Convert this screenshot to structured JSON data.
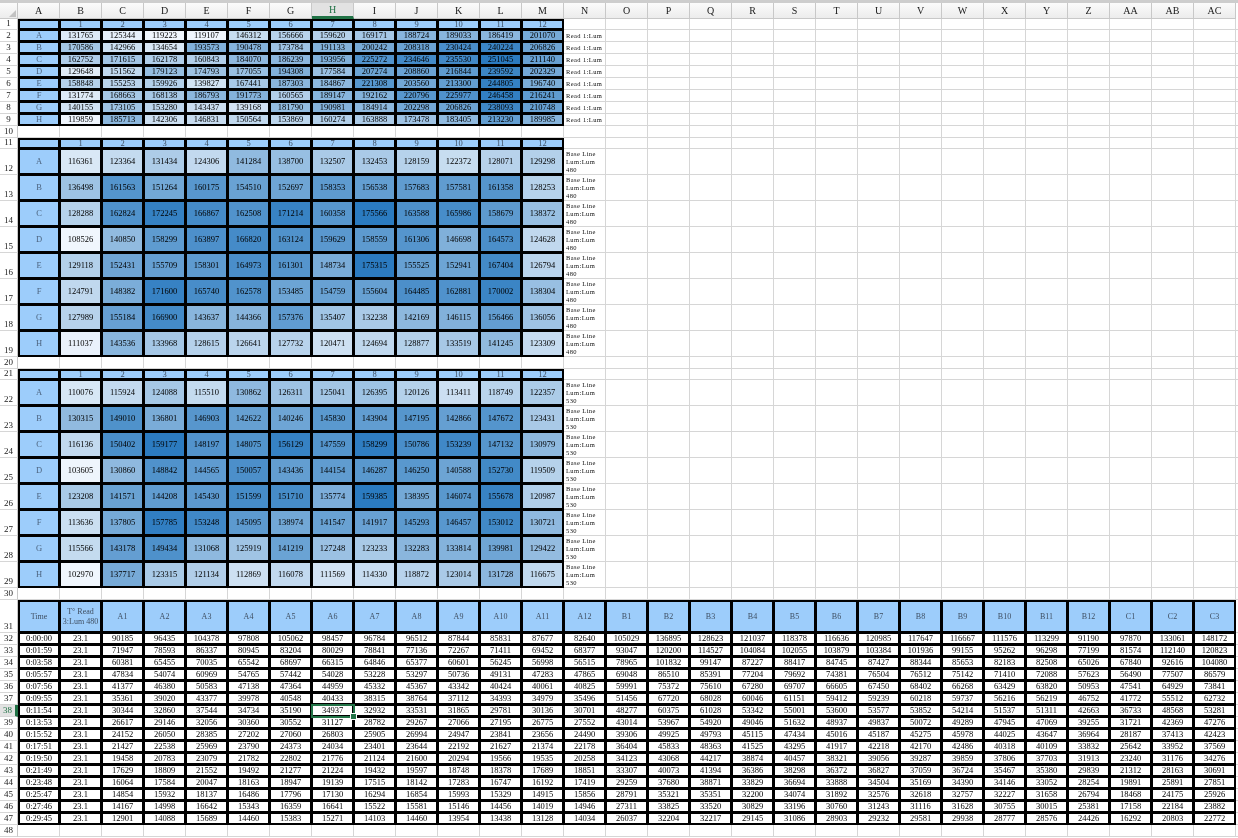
{
  "column_headers": [
    {
      "label": "A",
      "selected": false
    },
    {
      "label": "B",
      "selected": false
    },
    {
      "label": "C",
      "selected": false
    },
    {
      "label": "D",
      "selected": false
    },
    {
      "label": "E",
      "selected": false
    },
    {
      "label": "F",
      "selected": false
    },
    {
      "label": "G",
      "selected": false
    },
    {
      "label": "H",
      "selected": true
    },
    {
      "label": "I",
      "selected": false
    },
    {
      "label": "J",
      "selected": false
    },
    {
      "label": "K",
      "selected": false
    },
    {
      "label": "L",
      "selected": false
    },
    {
      "label": "M",
      "selected": false
    },
    {
      "label": "N",
      "selected": false
    },
    {
      "label": "O",
      "selected": false
    },
    {
      "label": "P",
      "selected": false
    },
    {
      "label": "Q",
      "selected": false
    },
    {
      "label": "R",
      "selected": false
    },
    {
      "label": "S",
      "selected": false
    },
    {
      "label": "T",
      "selected": false
    },
    {
      "label": "U",
      "selected": false
    },
    {
      "label": "V",
      "selected": false
    },
    {
      "label": "W",
      "selected": false
    },
    {
      "label": "X",
      "selected": false
    },
    {
      "label": "Y",
      "selected": false
    },
    {
      "label": "Z",
      "selected": false
    },
    {
      "label": "AA",
      "selected": false
    },
    {
      "label": "AB",
      "selected": false
    },
    {
      "label": "AC",
      "selected": false
    }
  ],
  "rows": [
    {
      "number": "1",
      "selected": false,
      "kind": "plate_head",
      "labels": [
        "1",
        "2",
        "3",
        "4",
        "5",
        "6",
        "7",
        "8",
        "9",
        "10",
        "11",
        "12"
      ]
    },
    {
      "number": "2",
      "selected": false,
      "kind": "plate_row",
      "label": "A",
      "values": [
        "131765",
        "125344",
        "119223",
        "119107",
        "146312",
        "156666",
        "159620",
        "169171",
        "188724",
        "189033",
        "186419",
        "201070"
      ],
      "note": "Read 1:Lum"
    },
    {
      "number": "3",
      "selected": false,
      "kind": "plate_row",
      "label": "B",
      "values": [
        "170586",
        "142966",
        "134654",
        "193573",
        "190478",
        "173784",
        "191133",
        "200242",
        "208318",
        "230424",
        "240224",
        "206826"
      ],
      "note": "Read 1:Lum"
    },
    {
      "number": "4",
      "selected": false,
      "kind": "plate_row",
      "label": "C",
      "values": [
        "162752",
        "171615",
        "162178",
        "160843",
        "184070",
        "186239",
        "193956",
        "225272",
        "234646",
        "235530",
        "251045",
        "211140"
      ],
      "note": "Read 1:Lum"
    },
    {
      "number": "5",
      "selected": false,
      "kind": "plate_row",
      "label": "D",
      "values": [
        "129648",
        "151562",
        "179123",
        "174793",
        "177055",
        "194308",
        "177584",
        "207274",
        "208860",
        "216844",
        "239592",
        "202329"
      ],
      "note": "Read 1:Lum"
    },
    {
      "number": "6",
      "selected": false,
      "kind": "plate_row",
      "label": "E",
      "values": [
        "158848",
        "155253",
        "159926",
        "139827",
        "167441",
        "187303",
        "184867",
        "221308",
        "203560",
        "213300",
        "244805",
        "196740"
      ],
      "note": "Read 1:Lum"
    },
    {
      "number": "7",
      "selected": false,
      "kind": "plate_row",
      "label": "F",
      "values": [
        "131774",
        "168663",
        "168138",
        "186793",
        "191773",
        "160565",
        "189147",
        "192162",
        "220796",
        "225977",
        "246458",
        "216241"
      ],
      "note": "Read 1:Lum"
    },
    {
      "number": "8",
      "selected": false,
      "kind": "plate_row",
      "label": "G",
      "values": [
        "140155",
        "173105",
        "153280",
        "143437",
        "139168",
        "181790",
        "190981",
        "184914",
        "202298",
        "206826",
        "238093",
        "210748"
      ],
      "note": "Read 1:Lum"
    },
    {
      "number": "9",
      "selected": false,
      "kind": "plate_row",
      "label": "H",
      "values": [
        "119859",
        "185713",
        "142306",
        "146831",
        "150564",
        "153869",
        "160274",
        "163888",
        "173478",
        "183405",
        "213230",
        "189985"
      ],
      "note": "Read 1:Lum"
    },
    {
      "number": "10",
      "selected": false,
      "kind": "blank"
    },
    {
      "number": "11",
      "selected": false,
      "kind": "plate_head",
      "labels": [
        "1",
        "2",
        "3",
        "4",
        "5",
        "6",
        "7",
        "8",
        "9",
        "10",
        "11",
        "12"
      ]
    },
    {
      "number": "12",
      "selected": false,
      "kind": "plate_row",
      "label": "A",
      "values": [
        "116361",
        "123364",
        "131434",
        "124306",
        "141284",
        "138700",
        "132507",
        "132453",
        "128159",
        "122372",
        "128071",
        "129298"
      ],
      "note": "Base Line Lum:Lum 480"
    },
    {
      "number": "13",
      "selected": false,
      "kind": "plate_row",
      "label": "B",
      "values": [
        "136498",
        "161563",
        "151264",
        "160175",
        "154510",
        "152697",
        "158353",
        "156538",
        "157683",
        "157581",
        "161358",
        "128253"
      ],
      "note": "Base Line Lum:Lum 480"
    },
    {
      "number": "14",
      "selected": false,
      "kind": "plate_row",
      "label": "C",
      "values": [
        "128288",
        "162824",
        "172245",
        "166867",
        "162508",
        "171214",
        "160358",
        "175566",
        "163588",
        "165986",
        "158679",
        "138372"
      ],
      "note": "Base Line Lum:Lum 480"
    },
    {
      "number": "15",
      "selected": false,
      "kind": "plate_row",
      "label": "D",
      "values": [
        "108526",
        "140850",
        "158299",
        "163897",
        "166820",
        "163124",
        "159629",
        "158559",
        "161306",
        "146698",
        "164573",
        "124628"
      ],
      "note": "Base Line Lum:Lum 480"
    },
    {
      "number": "16",
      "selected": false,
      "kind": "plate_row",
      "label": "E",
      "values": [
        "129118",
        "152431",
        "155709",
        "158301",
        "164973",
        "161301",
        "148734",
        "175315",
        "155525",
        "152941",
        "167404",
        "126794"
      ],
      "note": "Base Line Lum:Lum 480"
    },
    {
      "number": "17",
      "selected": false,
      "kind": "plate_row",
      "label": "F",
      "values": [
        "124791",
        "148382",
        "171600",
        "165740",
        "162578",
        "153485",
        "154759",
        "155604",
        "164485",
        "162881",
        "170002",
        "138304"
      ],
      "note": "Base Line Lum:Lum 480"
    },
    {
      "number": "18",
      "selected": false,
      "kind": "plate_row",
      "label": "G",
      "values": [
        "127989",
        "155184",
        "166900",
        "143637",
        "144366",
        "157376",
        "135407",
        "132238",
        "142169",
        "146115",
        "156466",
        "136056"
      ],
      "note": "Base Line Lum:Lum 480"
    },
    {
      "number": "19",
      "selected": false,
      "kind": "plate_row",
      "label": "H",
      "values": [
        "111037",
        "143536",
        "133968",
        "128615",
        "126641",
        "127732",
        "120471",
        "124694",
        "128877",
        "133519",
        "141245",
        "123309"
      ],
      "note": "Base Line Lum:Lum 480"
    },
    {
      "number": "20",
      "selected": false,
      "kind": "blank"
    },
    {
      "number": "21",
      "selected": false,
      "kind": "plate_head",
      "labels": [
        "1",
        "2",
        "3",
        "4",
        "5",
        "6",
        "7",
        "8",
        "9",
        "10",
        "11",
        "12"
      ]
    },
    {
      "number": "22",
      "selected": false,
      "kind": "plate_row",
      "label": "A",
      "values": [
        "110076",
        "115924",
        "124088",
        "115510",
        "130862",
        "126311",
        "125041",
        "126395",
        "120126",
        "113411",
        "118749",
        "122357"
      ],
      "note": "Base Line Lum:Lum 530"
    },
    {
      "number": "23",
      "selected": false,
      "kind": "plate_row",
      "label": "B",
      "values": [
        "130315",
        "149010",
        "136801",
        "146903",
        "142622",
        "140246",
        "145830",
        "143904",
        "147195",
        "142866",
        "147672",
        "123431"
      ],
      "note": "Base Line Lum:Lum 530"
    },
    {
      "number": "24",
      "selected": false,
      "kind": "plate_row",
      "label": "C",
      "values": [
        "116136",
        "150402",
        "159177",
        "148197",
        "148075",
        "156129",
        "147559",
        "158299",
        "150786",
        "153239",
        "147132",
        "130979"
      ],
      "note": "Base Line Lum:Lum 530"
    },
    {
      "number": "25",
      "selected": false,
      "kind": "plate_row",
      "label": "D",
      "values": [
        "103605",
        "130860",
        "148842",
        "144565",
        "150057",
        "143436",
        "144154",
        "146287",
        "146250",
        "140588",
        "152730",
        "119509"
      ],
      "note": "Base Line Lum:Lum 530"
    },
    {
      "number": "26",
      "selected": false,
      "kind": "plate_row",
      "label": "E",
      "values": [
        "123208",
        "141571",
        "144208",
        "145430",
        "151599",
        "151710",
        "135774",
        "159385",
        "138395",
        "146074",
        "155678",
        "120987"
      ],
      "note": "Base Line Lum:Lum 530"
    },
    {
      "number": "27",
      "selected": false,
      "kind": "plate_row",
      "label": "F",
      "values": [
        "113636",
        "137805",
        "157785",
        "153248",
        "145095",
        "138974",
        "141547",
        "141917",
        "145293",
        "146457",
        "153012",
        "130721"
      ],
      "note": "Base Line Lum:Lum 530"
    },
    {
      "number": "28",
      "selected": false,
      "kind": "plate_row",
      "label": "G",
      "values": [
        "115566",
        "143178",
        "149434",
        "131068",
        "125919",
        "141219",
        "127248",
        "123233",
        "132283",
        "133814",
        "139981",
        "129422"
      ],
      "note": "Base Line Lum:Lum 530"
    },
    {
      "number": "29",
      "selected": false,
      "kind": "plate_row",
      "label": "H",
      "values": [
        "102970",
        "137717",
        "123315",
        "121134",
        "112869",
        "116078",
        "111569",
        "114330",
        "118872",
        "123014",
        "131728",
        "116675"
      ],
      "note": "Base Line Lum:Lum 530"
    },
    {
      "number": "30",
      "selected": false,
      "kind": "blank"
    },
    {
      "number": "31",
      "selected": false,
      "kind": "table_head",
      "cells": [
        "Time",
        "T° Read 3:Lum 480",
        "A1",
        "A2",
        "A3",
        "A4",
        "A5",
        "A6",
        "A7",
        "A8",
        "A9",
        "A10",
        "A11",
        "A12",
        "B1",
        "B2",
        "B3",
        "B4",
        "B5",
        "B6",
        "B7",
        "B8",
        "B9",
        "B10",
        "B11",
        "B12",
        "C1",
        "C2",
        "C3"
      ]
    },
    {
      "number": "32",
      "selected": false,
      "kind": "table_row",
      "cells": [
        "0:00:00",
        "23.1",
        "90185",
        "96435",
        "104378",
        "97808",
        "105062",
        "98457",
        "96784",
        "96512",
        "87844",
        "85831",
        "87677",
        "82640",
        "105029",
        "136895",
        "128623",
        "121037",
        "118378",
        "116636",
        "120985",
        "117647",
        "116667",
        "111576",
        "113299",
        "91190",
        "97870",
        "133061",
        "148172"
      ]
    },
    {
      "number": "33",
      "selected": false,
      "kind": "table_row",
      "cells": [
        "0:01:59",
        "23.1",
        "71947",
        "78593",
        "86337",
        "80945",
        "83204",
        "80029",
        "78841",
        "77136",
        "72267",
        "71411",
        "69452",
        "68377",
        "93047",
        "120200",
        "114527",
        "104084",
        "102055",
        "103879",
        "103384",
        "101936",
        "99155",
        "95262",
        "96298",
        "77199",
        "81574",
        "112140",
        "120823"
      ]
    },
    {
      "number": "34",
      "selected": false,
      "kind": "table_row",
      "cells": [
        "0:03:58",
        "23.1",
        "60381",
        "65455",
        "70035",
        "65542",
        "68697",
        "66315",
        "64846",
        "65377",
        "60601",
        "56245",
        "56998",
        "56515",
        "78965",
        "101832",
        "99147",
        "87227",
        "88417",
        "84745",
        "87427",
        "88344",
        "85653",
        "82183",
        "82508",
        "65026",
        "67840",
        "92616",
        "104080"
      ]
    },
    {
      "number": "35",
      "selected": false,
      "kind": "table_row",
      "cells": [
        "0:05:57",
        "23.1",
        "47834",
        "54074",
        "60969",
        "54765",
        "57442",
        "54028",
        "53228",
        "53297",
        "50736",
        "49131",
        "47283",
        "47865",
        "69048",
        "86510",
        "85391",
        "77204",
        "79692",
        "74381",
        "76504",
        "76512",
        "75142",
        "71410",
        "72088",
        "57623",
        "56490",
        "77507",
        "86579"
      ]
    },
    {
      "number": "36",
      "selected": false,
      "kind": "table_row",
      "cells": [
        "0:07:56",
        "23.1",
        "41377",
        "46380",
        "50583",
        "47138",
        "47364",
        "44959",
        "45332",
        "45367",
        "43342",
        "40424",
        "40061",
        "40825",
        "59991",
        "75372",
        "75610",
        "67280",
        "69707",
        "66605",
        "67450",
        "68402",
        "66268",
        "63429",
        "63820",
        "50953",
        "47541",
        "64929",
        "73841"
      ]
    },
    {
      "number": "37",
      "selected": false,
      "kind": "table_row",
      "cells": [
        "0:09:55",
        "23.1",
        "35361",
        "39020",
        "43377",
        "39978",
        "40548",
        "40433",
        "38315",
        "38764",
        "37112",
        "34393",
        "34979",
        "35496",
        "51456",
        "67720",
        "68028",
        "60046",
        "61151",
        "59412",
        "59239",
        "60218",
        "59737",
        "56216",
        "56219",
        "46752",
        "41772",
        "55512",
        "62732"
      ]
    },
    {
      "number": "38",
      "selected": true,
      "kind": "table_row",
      "cells": [
        "0:11:54",
        "23.1",
        "30344",
        "32860",
        "37544",
        "34734",
        "35190",
        "34937",
        "32932",
        "33531",
        "31865",
        "29781",
        "30136",
        "30701",
        "48277",
        "60375",
        "61028",
        "53342",
        "55001",
        "53600",
        "53577",
        "53852",
        "54214",
        "51537",
        "51311",
        "42663",
        "36733",
        "48568",
        "53281"
      ]
    },
    {
      "number": "39",
      "selected": false,
      "kind": "table_row",
      "cells": [
        "0:13:53",
        "23.1",
        "26617",
        "29146",
        "32056",
        "30360",
        "30552",
        "31127",
        "28782",
        "29267",
        "27066",
        "27195",
        "26775",
        "27552",
        "43014",
        "53967",
        "54920",
        "49046",
        "51632",
        "48937",
        "49837",
        "50072",
        "49289",
        "47945",
        "47069",
        "39255",
        "31721",
        "42369",
        "47276"
      ]
    },
    {
      "number": "40",
      "selected": false,
      "kind": "table_row",
      "cells": [
        "0:15:52",
        "23.1",
        "24152",
        "26050",
        "28385",
        "27202",
        "27060",
        "26803",
        "25905",
        "26994",
        "24947",
        "23841",
        "23656",
        "24490",
        "39306",
        "49925",
        "49793",
        "45115",
        "47434",
        "45016",
        "45187",
        "45275",
        "45978",
        "44025",
        "43647",
        "36964",
        "28187",
        "37413",
        "42423"
      ]
    },
    {
      "number": "41",
      "selected": false,
      "kind": "table_row",
      "cells": [
        "0:17:51",
        "23.1",
        "21427",
        "22538",
        "25969",
        "23790",
        "24373",
        "24034",
        "23401",
        "23644",
        "22192",
        "21627",
        "21374",
        "22178",
        "36404",
        "45833",
        "48363",
        "41525",
        "43295",
        "41917",
        "42218",
        "42170",
        "42486",
        "40318",
        "40109",
        "33832",
        "25642",
        "33952",
        "37569"
      ]
    },
    {
      "number": "42",
      "selected": false,
      "kind": "table_row",
      "cells": [
        "0:19:50",
        "23.1",
        "19458",
        "20783",
        "23079",
        "21782",
        "22802",
        "21776",
        "21124",
        "21600",
        "20294",
        "19566",
        "19535",
        "20258",
        "34123",
        "43068",
        "44217",
        "38874",
        "40457",
        "38321",
        "39056",
        "39287",
        "39859",
        "37806",
        "37703",
        "31913",
        "23240",
        "31176",
        "34276"
      ]
    },
    {
      "number": "43",
      "selected": false,
      "kind": "table_row",
      "cells": [
        "0:21:49",
        "23.1",
        "17629",
        "18809",
        "21552",
        "19492",
        "21277",
        "21224",
        "19432",
        "19597",
        "18748",
        "18378",
        "17689",
        "18851",
        "33307",
        "40073",
        "41394",
        "36386",
        "38298",
        "36372",
        "36827",
        "37059",
        "36724",
        "35467",
        "35380",
        "29839",
        "21312",
        "28163",
        "30691"
      ]
    },
    {
      "number": "44",
      "selected": false,
      "kind": "table_row",
      "cells": [
        "0:23:48",
        "23.1",
        "16064",
        "17584",
        "20047",
        "18163",
        "18947",
        "19139",
        "17515",
        "18142",
        "17283",
        "16747",
        "16192",
        "17419",
        "29259",
        "37680",
        "38871",
        "33829",
        "36694",
        "33888",
        "34504",
        "35169",
        "34390",
        "34146",
        "33052",
        "28254",
        "19891",
        "25891",
        "27851"
      ]
    },
    {
      "number": "45",
      "selected": false,
      "kind": "table_row",
      "cells": [
        "0:25:47",
        "23.1",
        "14854",
        "15932",
        "18137",
        "16486",
        "17796",
        "17130",
        "16294",
        "16854",
        "15993",
        "15329",
        "14915",
        "15856",
        "28791",
        "35321",
        "35351",
        "32200",
        "34074",
        "31892",
        "32576",
        "32618",
        "32757",
        "32227",
        "31658",
        "26794",
        "18468",
        "24175",
        "25926"
      ]
    },
    {
      "number": "46",
      "selected": false,
      "kind": "table_row",
      "cells": [
        "0:27:46",
        "23.1",
        "14167",
        "14998",
        "16642",
        "15343",
        "16359",
        "16641",
        "15522",
        "15581",
        "15146",
        "14456",
        "14019",
        "14946",
        "27311",
        "33825",
        "33520",
        "30829",
        "33196",
        "30760",
        "31243",
        "31116",
        "31628",
        "30755",
        "30015",
        "25381",
        "17158",
        "22184",
        "23882"
      ]
    },
    {
      "number": "47",
      "selected": false,
      "kind": "table_row",
      "cells": [
        "0:29:45",
        "23.1",
        "12901",
        "14088",
        "15689",
        "14460",
        "15383",
        "15271",
        "14103",
        "14460",
        "13954",
        "13438",
        "13128",
        "14034",
        "26037",
        "32204",
        "32217",
        "29145",
        "31086",
        "28903",
        "29232",
        "29581",
        "29938",
        "28777",
        "28576",
        "24426",
        "16292",
        "20803",
        "22772"
      ]
    },
    {
      "number": "48",
      "selected": false,
      "kind": "blank"
    }
  ]
}
